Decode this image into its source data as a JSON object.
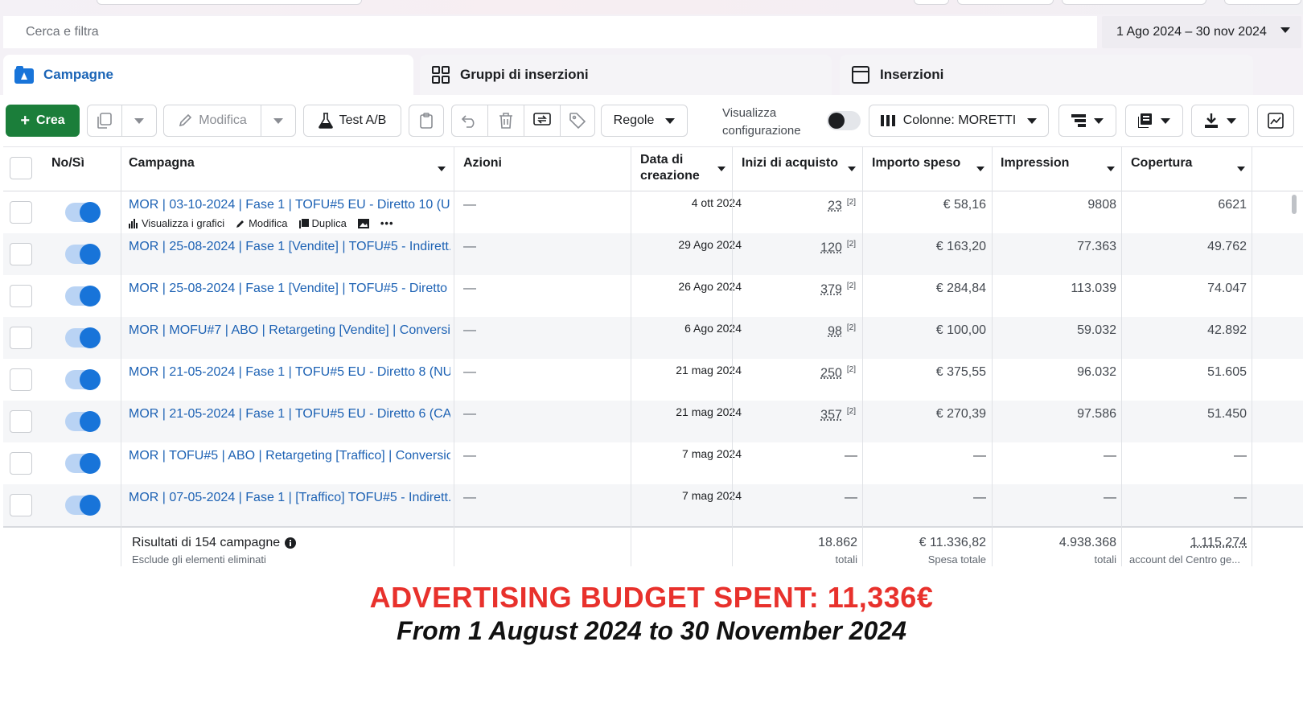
{
  "search": {
    "placeholder": "Cerca e filtra"
  },
  "date_range": "1 Ago 2024 – 30 nov 2024",
  "tabs": [
    {
      "label": "Campagne",
      "icon": "campaign-icon"
    },
    {
      "label": "Gruppi di inserzioni",
      "icon": "grid-icon"
    },
    {
      "label": "Inserzioni",
      "icon": "ad-window-icon"
    }
  ],
  "toolbar": {
    "create": "Crea",
    "edit": "Modifica",
    "ab_test": "Test A/B",
    "rules": "Regole",
    "view_config_line1": "Visualizza",
    "view_config_line2": "configurazione",
    "columns": "Colonne: MORETTI"
  },
  "table": {
    "headers": {
      "onoff": "No/Sì",
      "campaign": "Campagna",
      "actions": "Azioni",
      "created_line1": "Data di",
      "created_line2": "creazione",
      "purchases": "Inizi di acquisto",
      "spent": "Importo speso",
      "impressions": "Impression",
      "reach": "Copertura"
    },
    "row_actions": {
      "charts": "Visualizza i grafici",
      "edit": "Modifica",
      "duplicate": "Duplica"
    },
    "rows": [
      {
        "name": "MOR | 03-10-2024 | Fase 1 | TOFU#5 EU - Diretto 10 (U...",
        "actions": "—",
        "created": "4 ott 2024",
        "purchases": "23",
        "spent": "€ 58,16",
        "impressions": "9808",
        "reach": "6621"
      },
      {
        "name": "MOR | 25-08-2024 | Fase 1 [Vendite] | TOFU#5 - Indirett...",
        "actions": "—",
        "created": "29 Ago 2024",
        "purchases": "120",
        "spent": "€ 163,20",
        "impressions": "77.363",
        "reach": "49.762"
      },
      {
        "name": "MOR | 25-08-2024 | Fase 1 [Vendite] | TOFU#5 - Diretto ...",
        "actions": "—",
        "created": "26 Ago 2024",
        "purchases": "379",
        "spent": "€ 284,84",
        "impressions": "113.039",
        "reach": "74.047"
      },
      {
        "name": "MOR | MOFU#7 | ABO | Retargeting [Vendite] | Conversi...",
        "actions": "—",
        "created": "6 Ago 2024",
        "purchases": "98",
        "spent": "€ 100,00",
        "impressions": "59.032",
        "reach": "42.892"
      },
      {
        "name": "MOR | 21-05-2024 | Fase 1 | TOFU#5 EU - Diretto 8 (NU...",
        "actions": "—",
        "created": "21 mag 2024",
        "purchases": "250",
        "spent": "€ 375,55",
        "impressions": "96.032",
        "reach": "51.605"
      },
      {
        "name": "MOR | 21-05-2024 | Fase 1 | TOFU#5 EU - Diretto 6 (CA...",
        "actions": "—",
        "created": "21 mag 2024",
        "purchases": "357",
        "spent": "€ 270,39",
        "impressions": "97.586",
        "reach": "51.450"
      },
      {
        "name": "MOR | TOFU#5 | ABO | Retargeting [Traffico] | Conversio...",
        "actions": "—",
        "created": "7 mag 2024",
        "purchases": "—",
        "spent": "—",
        "impressions": "—",
        "reach": "—"
      },
      {
        "name": "MOR | 07-05-2024 | Fase 1 | [Traffico] TOFU#5 - Indirett...",
        "actions": "—",
        "created": "7 mag 2024",
        "purchases": "—",
        "spent": "—",
        "impressions": "—",
        "reach": "—"
      }
    ],
    "footnote_marker": "[2]",
    "summary": {
      "title": "Risultati di 154 campagne",
      "subtitle": "Esclude gli elementi eliminati",
      "purchases": "18.862",
      "purchases_label": "totali",
      "spent": "€ 11.336,82",
      "spent_label": "Spesa totale",
      "impressions": "4.938.368",
      "impressions_label": "totali",
      "reach": "1.115.274",
      "reach_label": "account del Centro ge..."
    }
  },
  "caption": {
    "headline": "ADVERTISING BUDGET SPENT: 11,336€",
    "subline": "From 1 August 2024 to 30 November 2024"
  },
  "colors": {
    "accent_blue": "#1874d9",
    "link_blue": "#1d62b4",
    "create_green": "#1b7e3a",
    "headline_red": "#e8312c"
  }
}
